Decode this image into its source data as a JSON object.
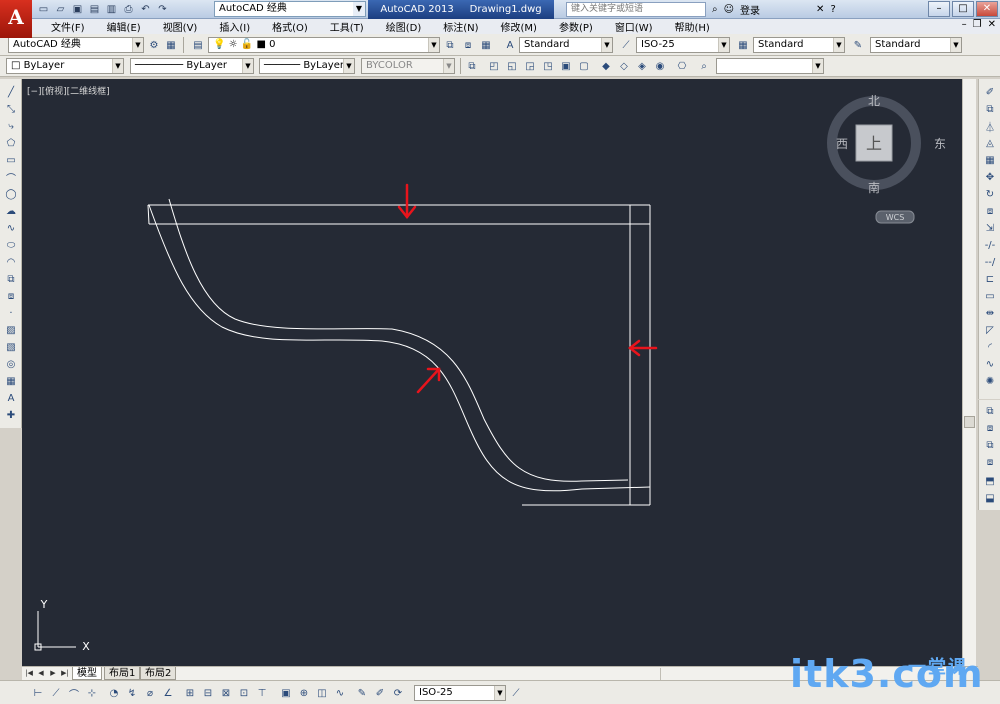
{
  "titlebar": {
    "app_logo": "A",
    "workspace": "AutoCAD 经典",
    "app_name": "AutoCAD 2013",
    "doc_name": "Drawing1.dwg",
    "search_placeholder": "键入关键字或短语",
    "login": "登录"
  },
  "menu": {
    "items": [
      "文件(F)",
      "编辑(E)",
      "视图(V)",
      "插入(I)",
      "格式(O)",
      "工具(T)",
      "绘图(D)",
      "标注(N)",
      "修改(M)",
      "参数(P)",
      "窗口(W)",
      "帮助(H)"
    ]
  },
  "toolbar1": {
    "workspace": "AutoCAD 经典",
    "layer": "0",
    "text_style": "Standard",
    "dim_style": "ISO-25",
    "table_style": "Standard",
    "mleader_style": "Standard"
  },
  "toolbar2": {
    "color": "ByLayer",
    "linetype": "ByLayer",
    "lineweight": "ByLayer",
    "plotstyle": "BYCOLOR"
  },
  "viewport": {
    "label": "[−][俯视][二维线框]",
    "viewcube": {
      "north": "北",
      "south": "南",
      "east": "东",
      "west": "西",
      "face": "上",
      "wcs": "WCS"
    },
    "ucs": {
      "x": "X",
      "y": "Y"
    }
  },
  "tabs": [
    "模型",
    "布局1",
    "布局2"
  ],
  "bottombar": {
    "dim_style": "ISO-25"
  },
  "watermark": {
    "text": "itk3",
    "suffix": ".com",
    "sub": "一堂课"
  },
  "colors": {
    "canvas": "#252a35",
    "lines": "#ffffff",
    "arrows": "#e8141c",
    "watermark": "#5fa8f2"
  }
}
